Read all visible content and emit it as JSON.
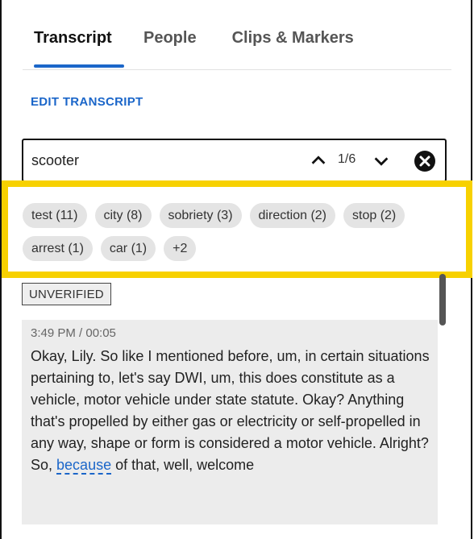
{
  "tabs": [
    {
      "label": "Transcript",
      "active": true
    },
    {
      "label": "People",
      "active": false
    },
    {
      "label": "Clips & Markers",
      "active": false
    }
  ],
  "edit_transcript_label": "EDIT TRANSCRIPT",
  "search": {
    "value": "scooter",
    "counter": "1/6",
    "nav_up_icon": "chevron-up-icon",
    "nav_down_icon": "chevron-down-icon",
    "clear_icon": "close-circle-icon"
  },
  "keyword_chips": [
    {
      "label": "test (11)"
    },
    {
      "label": "city (8)"
    },
    {
      "label": "sobriety (3)"
    },
    {
      "label": "direction (2)"
    },
    {
      "label": "stop (2)"
    },
    {
      "label": "arrest (1)"
    },
    {
      "label": "car (1)"
    },
    {
      "label": "+2"
    }
  ],
  "highlight_color": "#f7d100",
  "accent_color": "#1b66c9",
  "status_badge": "UNVERIFIED",
  "transcript": {
    "timestamp": "3:49 PM / 00:05",
    "text_before": "Okay, Lily. So like I mentioned before, um, in certain situations pertaining to, let's say DWI, um, this does constitute as a vehicle, motor vehicle under state statute. Okay? Anything that's propelled by either gas or electricity or self-propelled in any way, shape or form is considered a motor vehicle. Alright? So, ",
    "keyword": "because",
    "text_after": " of that, well, welcome"
  }
}
